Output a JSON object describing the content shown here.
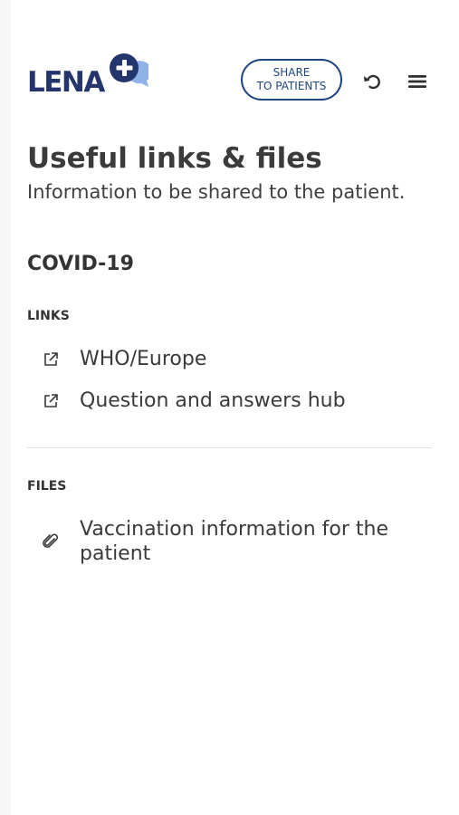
{
  "header": {
    "logo_text": "LENA",
    "share_line1": "SHARE",
    "share_line2": "TO PATIENTS",
    "icons": {
      "logo": "plus-chat-icon",
      "refresh": "undo-icon",
      "menu": "hamburger-menu-icon"
    }
  },
  "page": {
    "title": "Useful links & files",
    "subtitle": "Information to be shared to the patient."
  },
  "section": {
    "title": "COVID-19",
    "links_label": "LINKS",
    "links": [
      {
        "label": "WHO/Europe",
        "icon": "external-link-icon"
      },
      {
        "label": "Question and answers hub",
        "icon": "external-link-icon"
      }
    ],
    "files_label": "FILES",
    "files": [
      {
        "label": "Vaccination information for the patient",
        "icon": "paperclip-icon"
      }
    ]
  },
  "colors": {
    "brand_navy": "#24356e",
    "button_border": "#1f4680",
    "text": "#3b3b3b",
    "divider": "#dedede",
    "badge_bubble": "#8fb3e8"
  }
}
